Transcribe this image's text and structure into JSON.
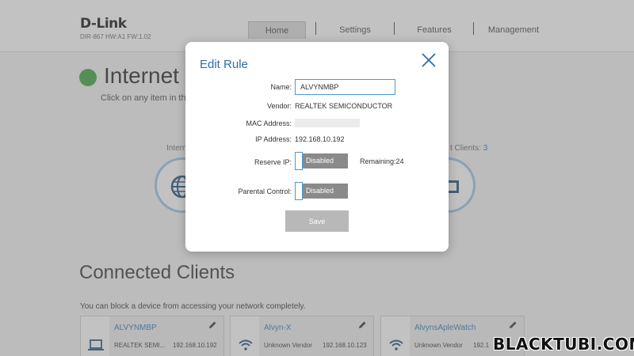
{
  "header": {
    "logo": "D-Link",
    "model": "DIR-867 HW:A1 FW:1.02",
    "nav": [
      {
        "label": "Home",
        "active": true
      },
      {
        "label": "Settings"
      },
      {
        "label": "Features"
      },
      {
        "label": "Management"
      }
    ]
  },
  "page": {
    "title_visible": "Internet C",
    "subtitle_visible": "Click on any item in the",
    "diagram_left_label": "Intern",
    "diagram_right_label_prefix": "t Clients: ",
    "diagram_right_count": "3",
    "status_color": "#39a33a"
  },
  "clients_section": {
    "title": "Connected Clients",
    "subtitle": "You can block a device from accessing your network completely.",
    "cards": [
      {
        "name": "ALVYNMBP",
        "vendor": "REALTEK SEMI...",
        "ip": "192.168.10.192",
        "icon": "laptop-icon"
      },
      {
        "name": "Alvyn-X",
        "vendor": "Unknown Vendor",
        "ip": "192.168.10.123",
        "icon": "wifi-icon"
      },
      {
        "name": "AlvynsApleWatch",
        "vendor": "Unknown Vendor",
        "ip": "192.1",
        "icon": "wifi-icon"
      }
    ]
  },
  "modal": {
    "title": "Edit Rule",
    "name_label": "Name:",
    "name_value": "ALVYNMBP",
    "vendor_label": "Vendor:",
    "vendor_value": "REALTEK SEMICONDUCTOR",
    "mac_label": "MAC Address:",
    "ip_label": "IP Address:",
    "ip_value": "192.168.10.192",
    "reserve_label": "Reserve IP:",
    "reserve_state": "Disabled",
    "remaining": "Remaining:24",
    "parental_label": "Parental Control:",
    "parental_state": "Disabled",
    "save_label": "Save"
  },
  "watermark": "BLACKTUBI.COM",
  "colors": {
    "accent": "#2c6ea8",
    "toggle_off": "#8a8a8a",
    "save_disabled": "#b8b8b8"
  }
}
